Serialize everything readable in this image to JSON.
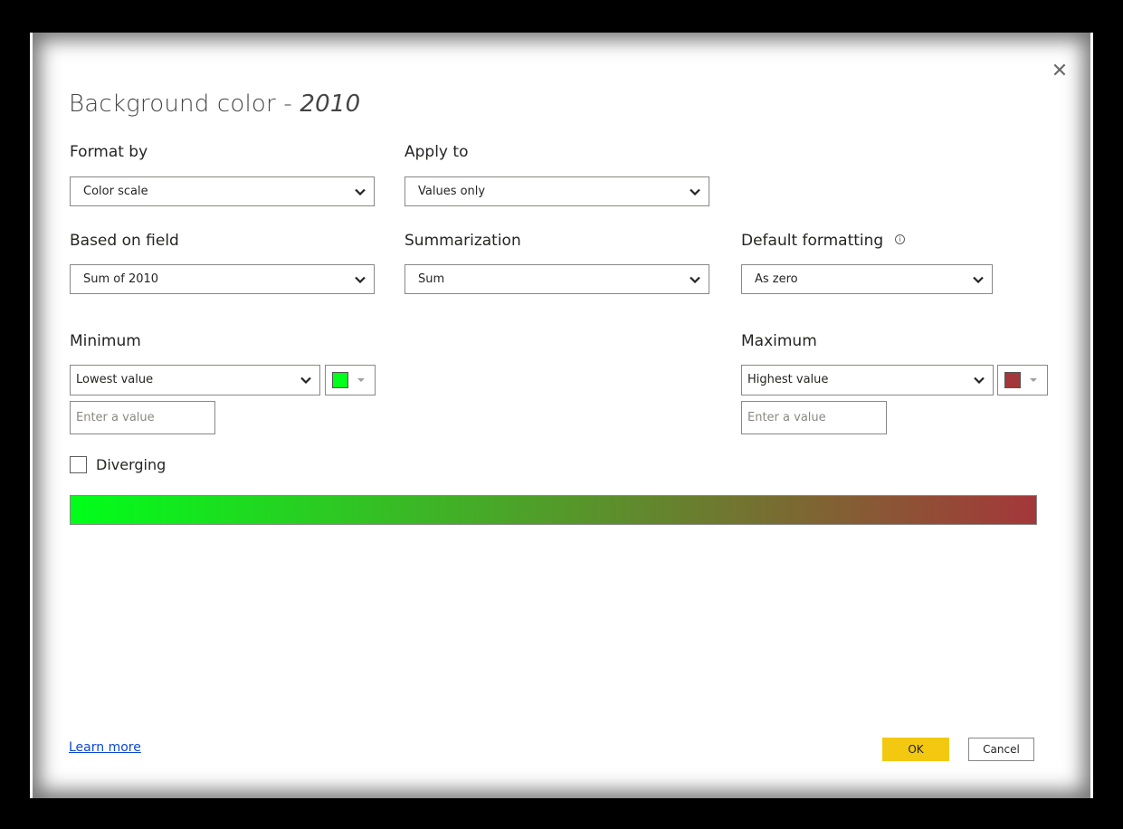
{
  "dialog": {
    "title_main": "Background color - ",
    "title_field": "2010",
    "close_glyph": "✕"
  },
  "format_by": {
    "label": "Format by",
    "value": "Color scale"
  },
  "apply_to": {
    "label": "Apply to",
    "value": "Values only"
  },
  "based_on_field": {
    "label": "Based on field",
    "value": "Sum of 2010"
  },
  "summarization": {
    "label": "Summarization",
    "value": "Sum"
  },
  "default_formatting": {
    "label": "Default formatting",
    "value": "As zero",
    "info_glyph": "i"
  },
  "minimum": {
    "label": "Minimum",
    "value": "Lowest value",
    "placeholder": "Enter a value",
    "color": "#00ff1a"
  },
  "maximum": {
    "label": "Maximum",
    "value": "Highest value",
    "placeholder": "Enter a value",
    "color": "#a4373a"
  },
  "diverging": {
    "label": "Diverging",
    "checked": false
  },
  "gradient": {
    "start": "#00ff1a",
    "end": "#a4373a"
  },
  "footer": {
    "learn_more": "Learn more",
    "ok": "OK",
    "cancel": "Cancel"
  },
  "colors": {
    "ok_button": "#f2c811",
    "link": "#0b47d6"
  }
}
